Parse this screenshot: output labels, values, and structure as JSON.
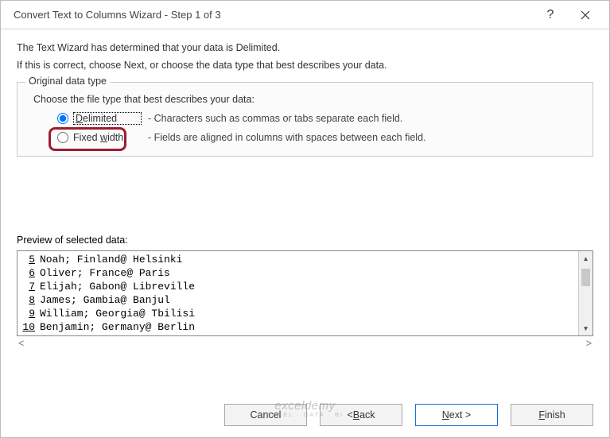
{
  "title": "Convert Text to Columns Wizard - Step 1 of 3",
  "intro1": "The Text Wizard has determined that your data is Delimited.",
  "intro2": "If this is correct, choose Next, or choose the data type that best describes your data.",
  "group": {
    "legend": "Original data type",
    "instruction": "Choose the file type that best describes your data:",
    "delimited": {
      "label_pre": "",
      "label_access": "D",
      "label_post": "elimited",
      "desc": "- Characters such as commas or tabs separate each field."
    },
    "fixed": {
      "label_pre": "Fixed ",
      "label_access": "w",
      "label_post": "idth",
      "desc": "- Fields are aligned in columns with spaces between each field."
    }
  },
  "preview_label": "Preview of selected data:",
  "preview_rows": {
    "r0": {
      "n": "5",
      "v": "Noah; Finland@ Helsinki"
    },
    "r1": {
      "n": "6",
      "v": "Oliver; France@ Paris"
    },
    "r2": {
      "n": "7",
      "v": "Elijah; Gabon@ Libreville"
    },
    "r3": {
      "n": "8",
      "v": "James; Gambia@ Banjul"
    },
    "r4": {
      "n": "9",
      "v": "William; Georgia@ Tbilisi"
    },
    "r5": {
      "n": "10",
      "v": "Benjamin; Germany@ Berlin"
    }
  },
  "buttons": {
    "cancel": "Cancel",
    "back_pre": "< ",
    "back_access": "B",
    "back_post": "ack",
    "next_access": "N",
    "next_post": "ext >",
    "finish_access": "F",
    "finish_post": "inish"
  },
  "watermark": {
    "main": "exceldemy",
    "sub": "EXCEL · DATA · BI"
  }
}
